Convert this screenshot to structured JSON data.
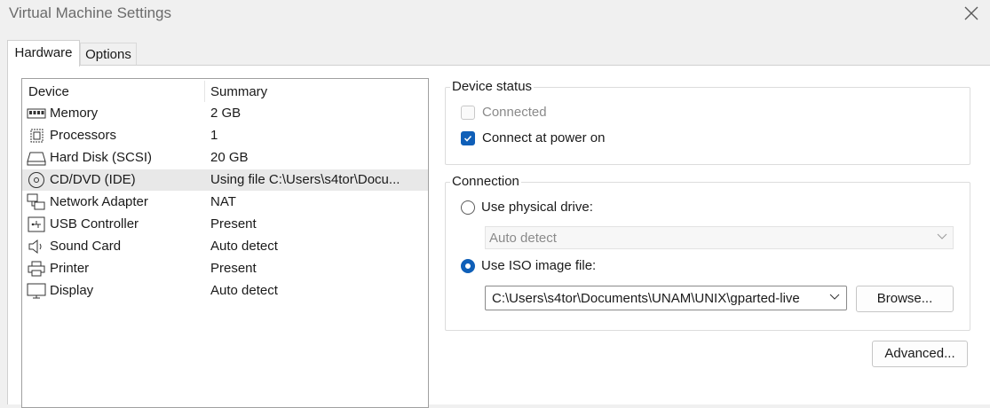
{
  "window": {
    "title": "Virtual Machine Settings"
  },
  "tabs": [
    {
      "label": "Hardware"
    },
    {
      "label": "Options"
    }
  ],
  "device_list": {
    "columns": {
      "device": "Device",
      "summary": "Summary"
    },
    "rows": [
      {
        "icon": "memory-icon",
        "name": "Memory",
        "summary": "2 GB"
      },
      {
        "icon": "processor-icon",
        "name": "Processors",
        "summary": "1"
      },
      {
        "icon": "hard-disk-icon",
        "name": "Hard Disk (SCSI)",
        "summary": "20 GB"
      },
      {
        "icon": "cd-dvd-icon",
        "name": "CD/DVD (IDE)",
        "summary": "Using file C:\\Users\\s4tor\\Docu..."
      },
      {
        "icon": "network-adapter-icon",
        "name": "Network Adapter",
        "summary": "NAT"
      },
      {
        "icon": "usb-icon",
        "name": "USB Controller",
        "summary": "Present"
      },
      {
        "icon": "sound-card-icon",
        "name": "Sound Card",
        "summary": "Auto detect"
      },
      {
        "icon": "printer-icon",
        "name": "Printer",
        "summary": "Present"
      },
      {
        "icon": "display-icon",
        "name": "Display",
        "summary": "Auto detect"
      }
    ],
    "selected_row": "CD/DVD (IDE)"
  },
  "device_status": {
    "label": "Device status",
    "connected": {
      "label": "Connected",
      "checked": false,
      "disabled": true
    },
    "connect_at_power_on": {
      "label": "Connect at power on",
      "checked": true
    }
  },
  "connection": {
    "label": "Connection",
    "physical_drive": {
      "label": "Use physical drive:",
      "selected": false,
      "value": "Auto detect"
    },
    "iso_image": {
      "label": "Use ISO image file:",
      "selected": true,
      "value": "C:\\Users\\s4tor\\Documents\\UNAM\\UNIX\\gparted-live"
    },
    "browse_label": "Browse..."
  },
  "advanced_label": "Advanced...",
  "colors": {
    "accent": "#0f5fb8",
    "selection": "#e8e8e8"
  }
}
